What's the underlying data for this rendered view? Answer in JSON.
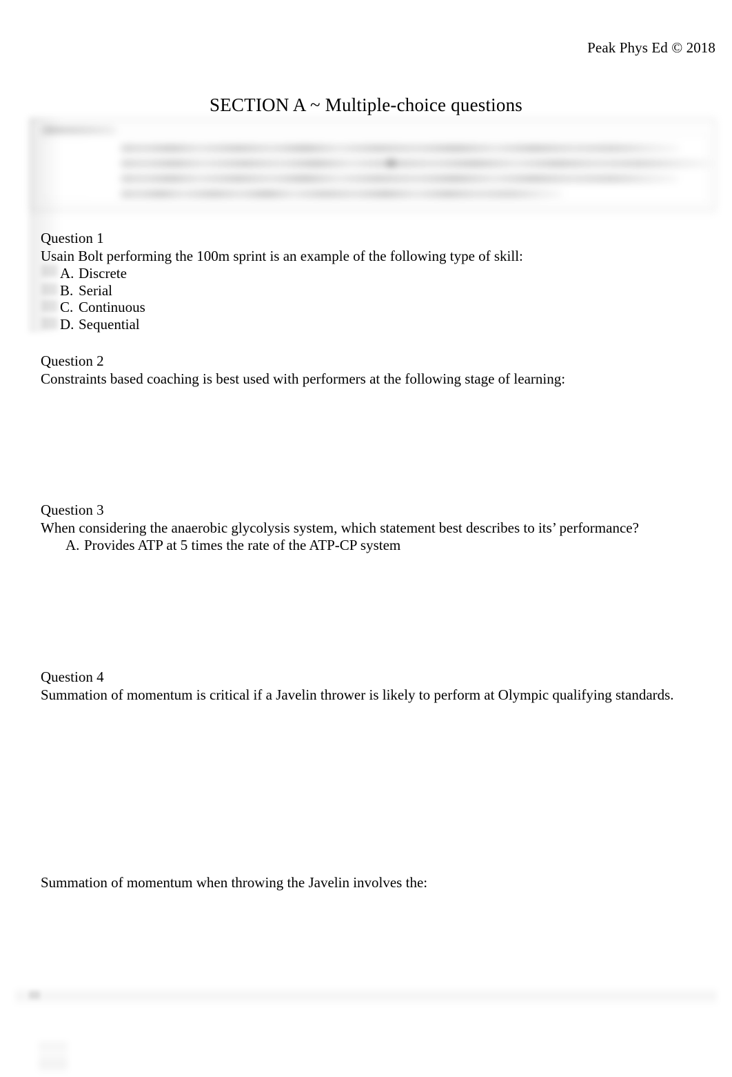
{
  "document": {
    "header_copyright": "Peak Phys Ed © 2018",
    "section_title": "SECTION A ~ Multiple-choice questions"
  },
  "instructions": {
    "state": "blurred-unreadable",
    "visible_text": ""
  },
  "questions": [
    {
      "label": "Question 1",
      "stem": "Usain Bolt performing the 100m sprint is an example of the following type of skill:",
      "options": [
        {
          "letter": "A.",
          "text": "Discrete"
        },
        {
          "letter": "B.",
          "text": "Serial"
        },
        {
          "letter": "C.",
          "text": "Continuous"
        },
        {
          "letter": "D.",
          "text": "Sequential"
        }
      ]
    },
    {
      "label": "Question 2",
      "stem": "Constraints based coaching is best used with performers at the following stage of learning:",
      "options": []
    },
    {
      "label": "Question 3",
      "stem": "When considering the anaerobic glycolysis system, which statement best describes to its’ performance?",
      "options": [
        {
          "letter": "A.",
          "text": "Provides ATP at 5 times the rate of the ATP-CP system"
        }
      ]
    },
    {
      "label": "Question 4",
      "stem": "Summation of momentum is critical if a Javelin thrower is likely to perform at Olympic qualifying standards.",
      "options": []
    }
  ],
  "standalone_prompt": "Summation of momentum when throwing the Javelin involves the:"
}
